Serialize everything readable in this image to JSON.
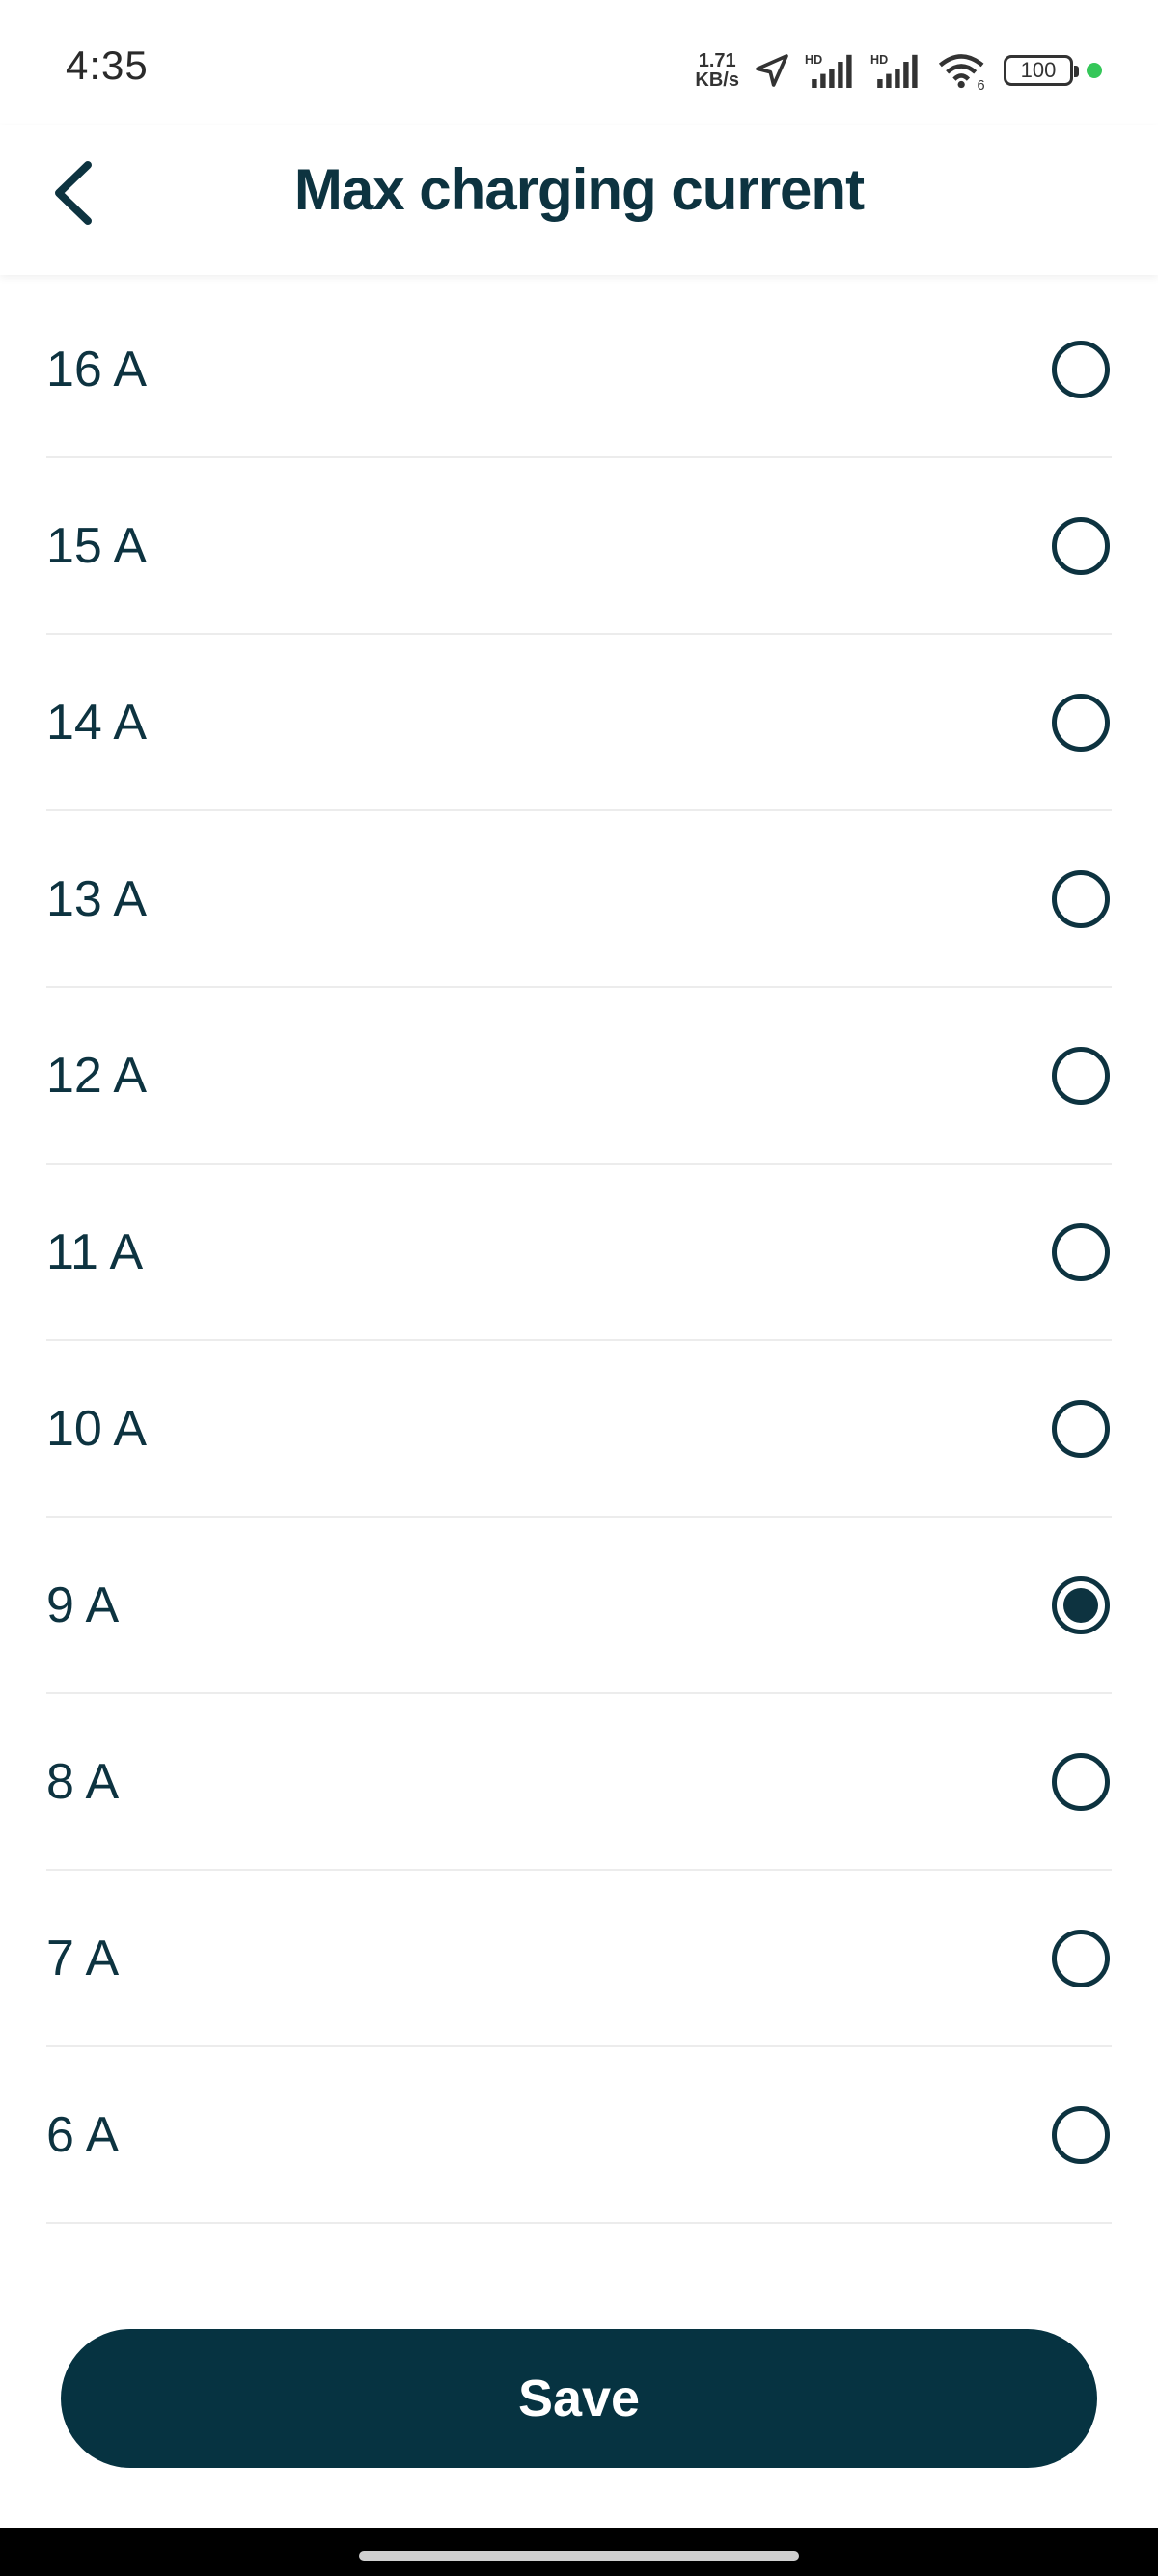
{
  "status_bar": {
    "time": "4:35",
    "net_speed_value": "1.71",
    "net_speed_unit": "KB/s",
    "battery": "100",
    "icons": [
      "location-arrow-icon",
      "hd-signal-icon",
      "hd-signal-icon",
      "wifi-6-icon",
      "battery-icon",
      "privacy-dot-icon"
    ]
  },
  "header": {
    "back_icon": "chevron-left-icon",
    "title": "Max charging current"
  },
  "options": [
    {
      "label": "16 A",
      "selected": false
    },
    {
      "label": "15 A",
      "selected": false
    },
    {
      "label": "14 A",
      "selected": false
    },
    {
      "label": "13 A",
      "selected": false
    },
    {
      "label": "12 A",
      "selected": false
    },
    {
      "label": "11 A",
      "selected": false
    },
    {
      "label": "10 A",
      "selected": false
    },
    {
      "label": "9 A",
      "selected": true
    },
    {
      "label": "8 A",
      "selected": false
    },
    {
      "label": "7 A",
      "selected": false
    },
    {
      "label": "6 A",
      "selected": false
    }
  ],
  "footer": {
    "save_label": "Save"
  },
  "colors": {
    "primary": "#063341",
    "text": "#0d3340",
    "divider": "#ececec"
  }
}
